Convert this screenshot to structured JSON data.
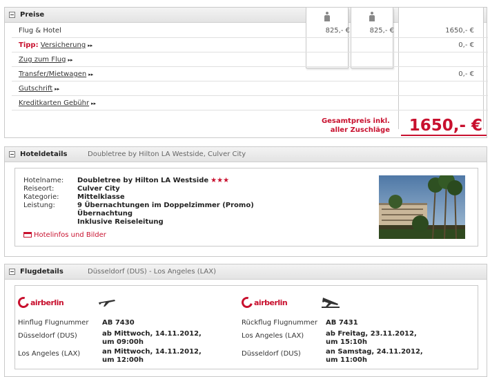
{
  "preise": {
    "title": "Preise",
    "rows": [
      {
        "label": "Flug & Hotel",
        "p1": "825,- €",
        "p2": "825,- €",
        "total": "1650,- €"
      },
      {
        "tipp": "Tipp:",
        "label": "Versicherung",
        "p1": "",
        "p2": "",
        "total": "0,- €"
      },
      {
        "label": "Zug zum Flug",
        "p1": "",
        "p2": "",
        "total": ""
      },
      {
        "label": "Transfer/Mietwagen",
        "p1": "",
        "p2": "",
        "total": "0,- €"
      },
      {
        "label": "Gutschrift",
        "p1": "",
        "p2": "",
        "total": ""
      },
      {
        "label": "Kreditkarten Gebühr",
        "p1": "",
        "p2": "",
        "total": ""
      }
    ],
    "gesamt_line1": "Gesamtpreis inkl.",
    "gesamt_line2": "aller Zuschläge",
    "gesamt_value": "1650,- €",
    "arrows": "▸▸"
  },
  "hotel": {
    "title": "Hoteldetails",
    "subtitle": "Doubletree by Hilton LA Westside, Culver City",
    "fields": {
      "name_key": "Hotelname:",
      "name_val": "Doubletree by Hilton LA Westside",
      "stars": "★★★",
      "ort_key": "Reiseort:",
      "ort_val": "Culver City",
      "kat_key": "Kategorie:",
      "kat_val": "Mittelklasse",
      "leist_key": "Leistung:",
      "leist_val1": "9 Übernachtungen im Doppelzimmer (Promo)",
      "leist_val2": "Übernachtung",
      "leist_val3": "Inklusive Reiseleitung"
    },
    "link": "Hotelinfos und Bilder"
  },
  "flug": {
    "title": "Flugdetails",
    "subtitle": "Düsseldorf (DUS) - Los Angeles (LAX)",
    "airline": "airberlin",
    "hin": {
      "label": "Hinflug Flugnummer",
      "number": "AB 7430",
      "from": "Düsseldorf (DUS)",
      "dep1": "ab Mittwoch, 14.11.2012,",
      "dep2": "um 09:00h",
      "to": "Los Angeles (LAX)",
      "arr1": "an Mittwoch, 14.11.2012,",
      "arr2": "um 12:00h"
    },
    "rueck": {
      "label": "Rückflug Flugnummer",
      "number": "AB 7431",
      "from": "Los Angeles (LAX)",
      "dep1": "ab Freitag, 23.11.2012,",
      "dep2": "um 15:10h",
      "to": "Düsseldorf (DUS)",
      "arr1": "an Samstag, 24.11.2012,",
      "arr2": "um 11:00h"
    }
  }
}
